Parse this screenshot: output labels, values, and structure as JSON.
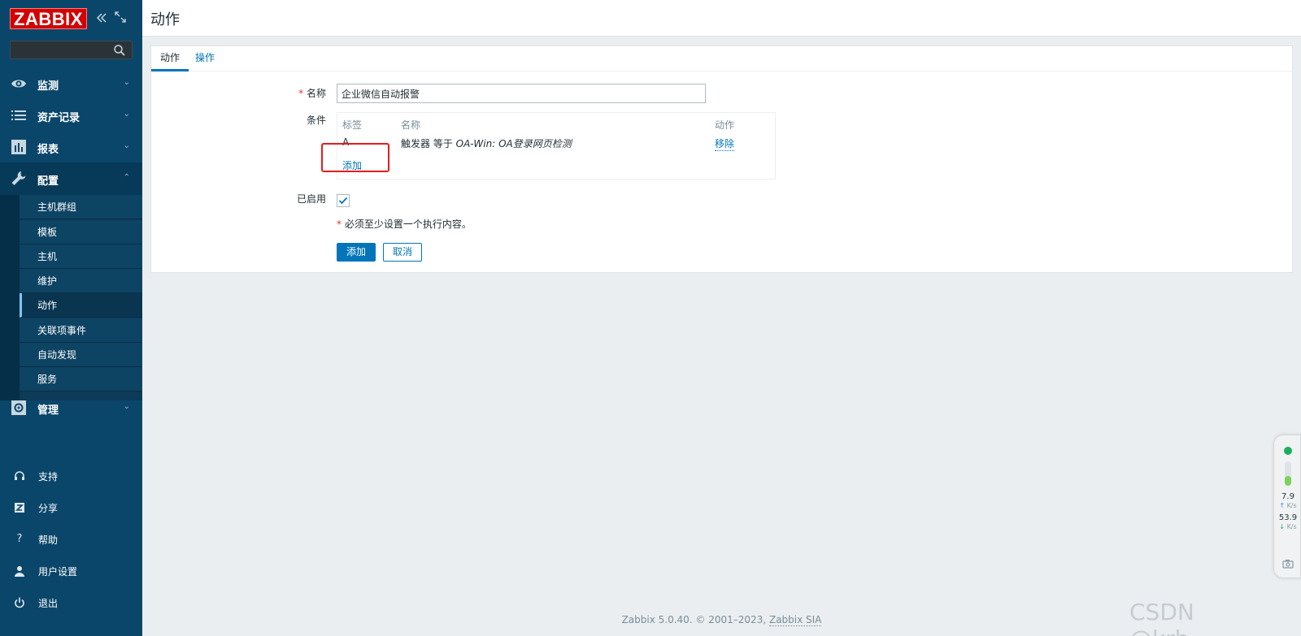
{
  "sidebar": {
    "logo": "ZABBIX",
    "collapse_icon": "double-chevron-left-icon",
    "kiosk_icon": "expand-icon",
    "search_placeholder": "",
    "menu": [
      {
        "label": "监测",
        "icon": "eye-icon",
        "expanded": false
      },
      {
        "label": "资产记录",
        "icon": "list-icon",
        "expanded": false
      },
      {
        "label": "报表",
        "icon": "bar-chart-icon",
        "expanded": false
      },
      {
        "label": "配置",
        "icon": "wrench-icon",
        "expanded": true
      },
      {
        "label": "管理",
        "icon": "cog-icon",
        "expanded": false
      }
    ],
    "config_submenu": [
      "主机群组",
      "模板",
      "主机",
      "维护",
      "动作",
      "关联项事件",
      "自动发现",
      "服务"
    ],
    "selected_submenu": "动作",
    "bottom": [
      {
        "label": "支持",
        "icon": "headset-icon"
      },
      {
        "label": "分享",
        "icon": "share-z-icon"
      },
      {
        "label": "帮助",
        "icon": "help-icon"
      },
      {
        "label": "用户设置",
        "icon": "user-icon"
      },
      {
        "label": "退出",
        "icon": "power-icon"
      }
    ]
  },
  "header": {
    "title": "动作"
  },
  "tabs": [
    {
      "label": "动作",
      "active": true
    },
    {
      "label": "操作",
      "active": false
    }
  ],
  "form": {
    "name_label": "名称",
    "name_value": "企业微信自动报警",
    "conditions_label": "条件",
    "conditions": {
      "headers": {
        "tag": "标签",
        "name": "名称",
        "action": "动作"
      },
      "rows": [
        {
          "tag": "A",
          "name_prefix": "触发器 等于 ",
          "name_value": "OA-Win: OA登录网页检测",
          "action": "移除"
        }
      ],
      "add_link": "添加"
    },
    "enabled_label": "已启用",
    "enabled": true,
    "required_note": "必须至少设置一个执行内容。",
    "required_marker": "*",
    "add_button": "添加",
    "cancel_button": "取消"
  },
  "footer": {
    "text": "Zabbix 5.0.40. © 2001–2023, ",
    "link": "Zabbix SIA"
  },
  "watermark": "CSDN @krb____",
  "net_widget": {
    "upload_value": "7.9",
    "upload_unit": "K/s",
    "download_value": "53.9",
    "download_unit": "K/s"
  },
  "colors": {
    "sidebar": "#0a466a",
    "accent": "#0275b8",
    "required": "#e33734",
    "highlight": "#e41d1d",
    "logo": "#d40000"
  }
}
